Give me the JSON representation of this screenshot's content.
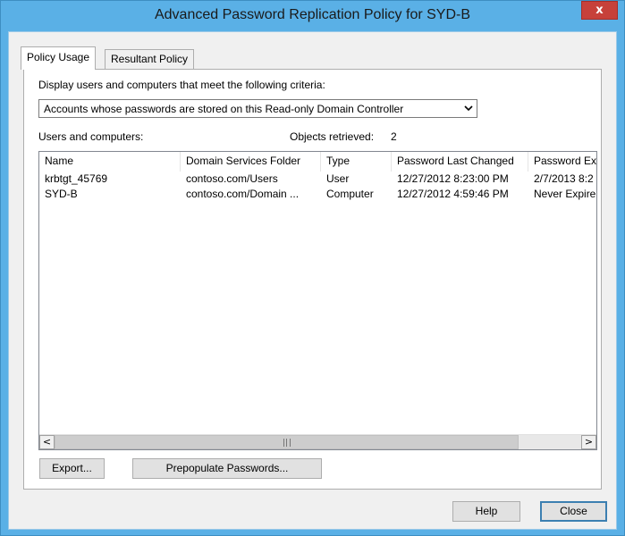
{
  "window": {
    "title": "Advanced Password Replication Policy for SYD-B",
    "close_glyph": "x"
  },
  "tabs": [
    {
      "label": "Policy Usage",
      "active": true
    },
    {
      "label": "Resultant Policy",
      "active": false
    }
  ],
  "criteria": {
    "label": "Display users and computers that meet the following criteria:",
    "selected": "Accounts whose passwords are stored on this Read-only Domain Controller"
  },
  "users_label": "Users and computers:",
  "objects": {
    "label": "Objects retrieved:",
    "count": "2"
  },
  "list": {
    "columns": [
      "Name",
      "Domain Services Folder",
      "Type",
      "Password Last Changed",
      "Password Ex"
    ],
    "rows": [
      [
        "krbtgt_45769",
        "contoso.com/Users",
        "User",
        "12/27/2012 8:23:00 PM",
        "2/7/2013 8:2"
      ],
      [
        "SYD-B",
        "contoso.com/Domain ...",
        "Computer",
        "12/27/2012 4:59:46 PM",
        "Never Expire"
      ]
    ]
  },
  "scrollbar": {
    "left_glyph": "<",
    "right_glyph": ">",
    "grip_glyph": "III"
  },
  "buttons": {
    "export": "Export...",
    "prepopulate": "Prepopulate Passwords...",
    "help": "Help",
    "close": "Close"
  },
  "colors": {
    "title_bar": "#5ab0e6",
    "close_button": "#c7413a",
    "default_button_border": "#3c7fb1"
  }
}
